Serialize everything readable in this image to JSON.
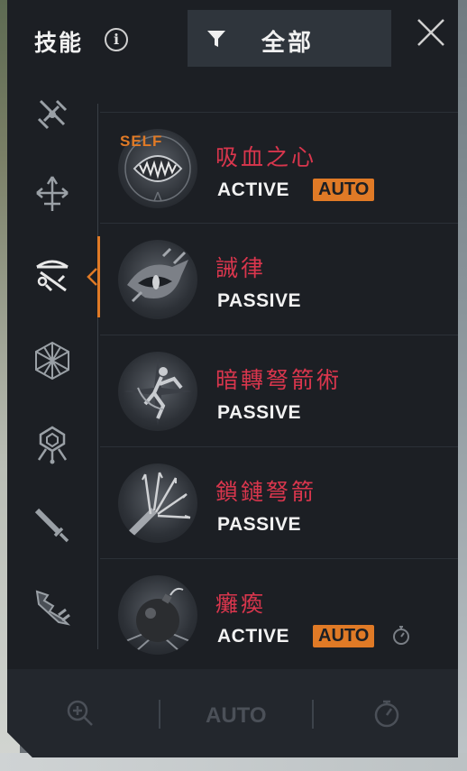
{
  "header": {
    "title": "技能",
    "info_icon": "info-icon",
    "filter_icon": "funnel-icon",
    "filter_label": "全部",
    "close_icon": "close-icon"
  },
  "sidebar": {
    "categories": [
      {
        "icon": "crossed-blades-icon",
        "active": false
      },
      {
        "icon": "arrows-icon",
        "active": false
      },
      {
        "icon": "crossbow-icon",
        "active": true
      },
      {
        "icon": "polyhedron-icon",
        "active": false
      },
      {
        "icon": "crest-icon",
        "active": false
      },
      {
        "icon": "sword-icon",
        "active": false
      },
      {
        "icon": "broken-blade-icon",
        "active": false
      }
    ]
  },
  "skills": [
    {
      "name": "吸血之心",
      "type": "ACTIVE",
      "auto": "AUTO",
      "tag": "SELF",
      "icon": "fanged-mouth-icon"
    },
    {
      "name": "誡律",
      "type": "PASSIVE",
      "icon": "dragon-eye-icon"
    },
    {
      "name": "暗轉弩箭術",
      "type": "PASSIVE",
      "icon": "archer-silhouette-icon"
    },
    {
      "name": "鎖鏈弩箭",
      "type": "PASSIVE",
      "icon": "bolt-volley-icon"
    },
    {
      "name": "癱瘓",
      "type": "ACTIVE",
      "auto": "AUTO",
      "icon": "bomb-icon",
      "timer_icon": "stopwatch-icon"
    }
  ],
  "footer": {
    "zoom_icon": "zoom-in-icon",
    "auto_label": "AUTO",
    "timer_icon": "stopwatch-icon"
  },
  "colors": {
    "accent": "#e07a26",
    "skill_name": "#d9364d",
    "panel_bg": "#1c1f24"
  }
}
